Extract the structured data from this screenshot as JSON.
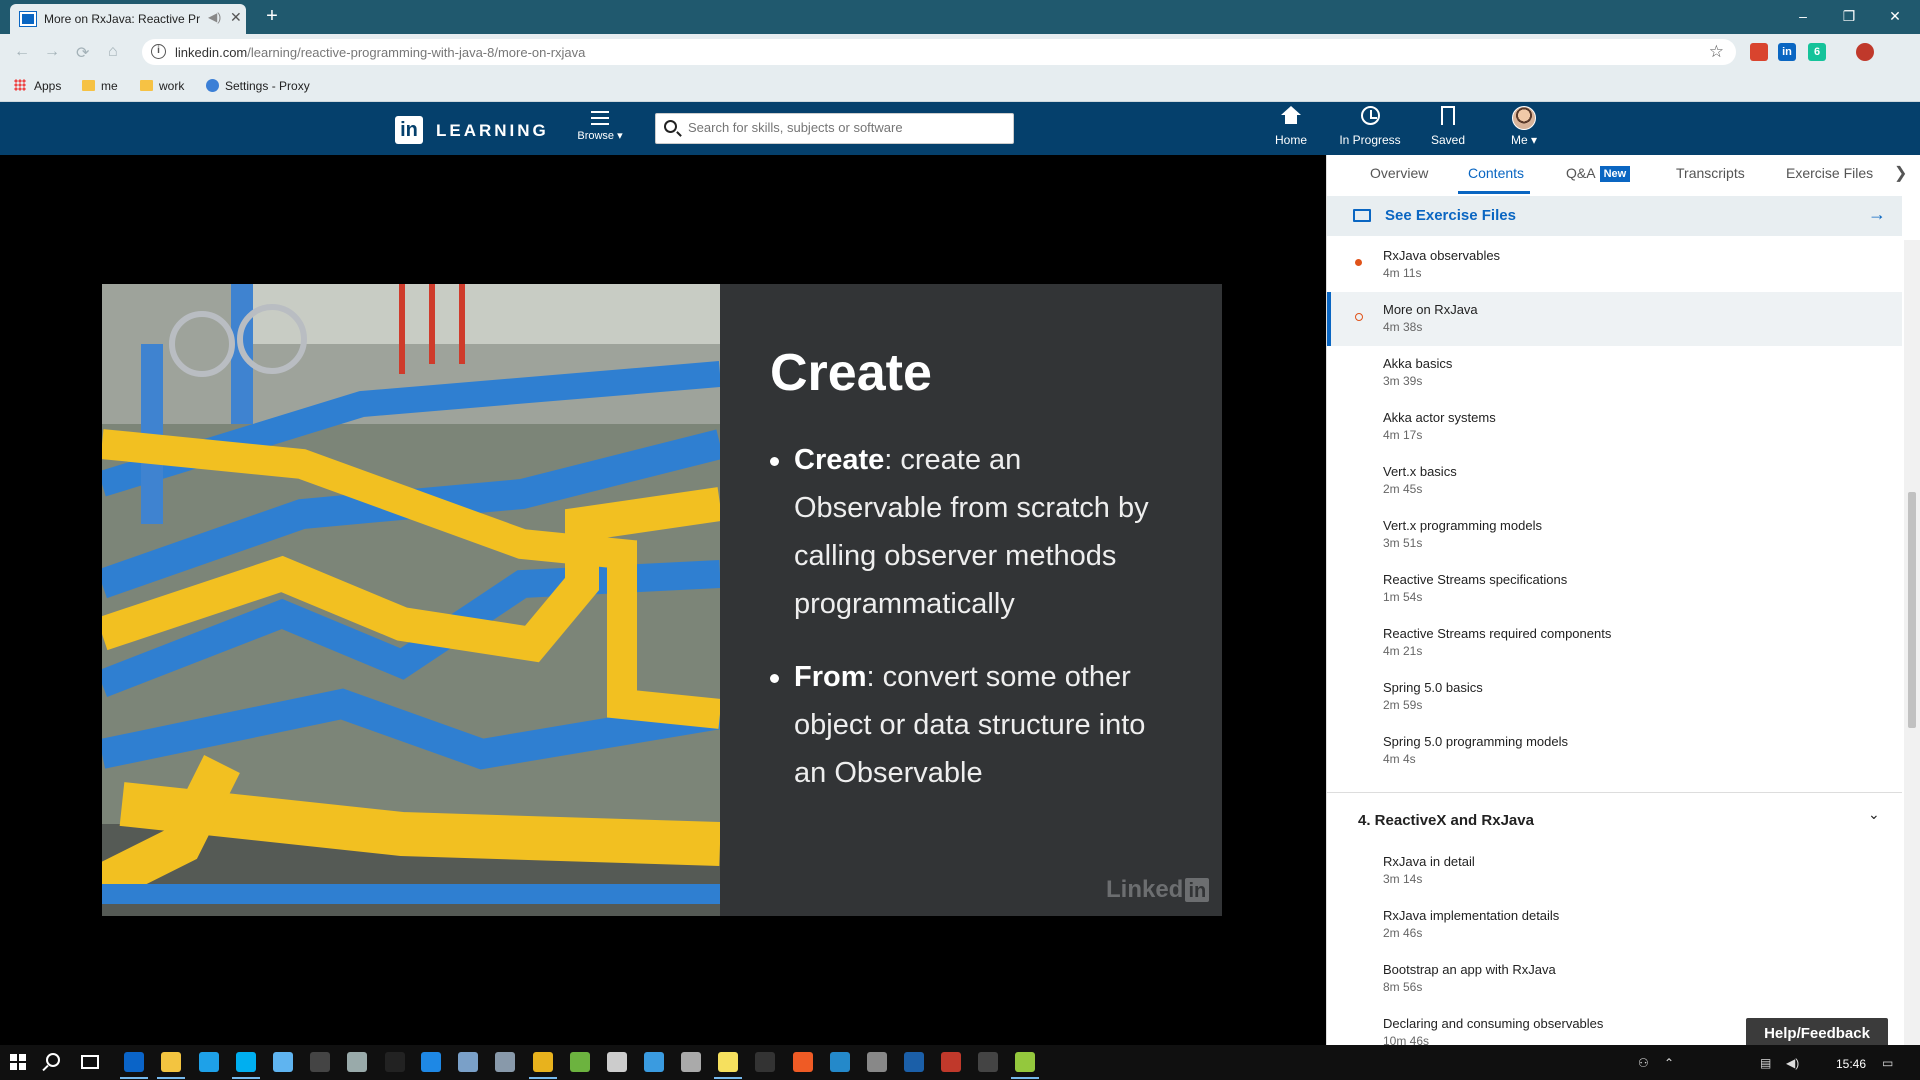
{
  "browser": {
    "tab_title": "More on RxJava: Reactive Pr",
    "new_tab": "+",
    "url_host": "linkedin.com",
    "url_path": "/learning/reactive-programming-with-java-8/more-on-rxjava",
    "window_controls": [
      "–",
      "❐",
      "✕"
    ],
    "nav": [
      "←",
      "→",
      "⟳",
      "⌂"
    ],
    "extensions": [
      {
        "icon": "chrome-extension-icon",
        "color": "#d9442e",
        "label": ""
      },
      {
        "icon": "linkedin-extension-icon",
        "color": "#0a66c2",
        "label": "in"
      },
      {
        "icon": "grammarly-extension-icon",
        "color": "#15c39a",
        "label": "6"
      },
      {
        "icon": "adblock-extension-icon",
        "color": "#c0392b",
        "label": ""
      }
    ],
    "bookmarks": [
      "Apps",
      "me",
      "work",
      "Settings - Proxy"
    ]
  },
  "header": {
    "logo_in": "in",
    "logo_text": "LEARNING",
    "browse": "Browse ▾",
    "search_placeholder": "Search for skills, subjects or software",
    "nav": {
      "home": "Home",
      "in_progress": "In Progress",
      "saved": "Saved",
      "me": "Me ▾"
    }
  },
  "slide": {
    "title": "Create",
    "bullets": [
      {
        "term": "Create",
        "text": ": create an Observable from scratch by calling observer methods programmatically"
      },
      {
        "term": "From",
        "text": ": convert some other object or data structure into an Observable"
      }
    ],
    "watermark_text": "Linked",
    "watermark_in": "in"
  },
  "panel": {
    "tabs": [
      "Overview",
      "Contents",
      "Q&A",
      "Transcripts",
      "Exercise Files"
    ],
    "active_tab": "Contents",
    "new_badge": "New",
    "next_arrow": "❯",
    "exercise_files": "See Exercise Files",
    "exercise_arrow": "→",
    "items": [
      {
        "title": "RxJava observables",
        "duration": "4m 11s",
        "status": "watched"
      },
      {
        "title": "More on RxJava",
        "duration": "4m 38s",
        "status": "current"
      },
      {
        "title": "Akka basics",
        "duration": "3m 39s",
        "status": "none"
      },
      {
        "title": "Akka actor systems",
        "duration": "4m 17s",
        "status": "none"
      },
      {
        "title": "Vert.x basics",
        "duration": "2m 45s",
        "status": "none"
      },
      {
        "title": "Vert.x programming models",
        "duration": "3m 51s",
        "status": "none"
      },
      {
        "title": "Reactive Streams specifications",
        "duration": "1m 54s",
        "status": "none"
      },
      {
        "title": "Reactive Streams required components",
        "duration": "4m 21s",
        "status": "none"
      },
      {
        "title": "Spring 5.0 basics",
        "duration": "2m 59s",
        "status": "none"
      },
      {
        "title": "Spring 5.0 programming models",
        "duration": "4m 4s",
        "status": "none"
      }
    ],
    "section4": {
      "title": "4. ReactiveX and RxJava",
      "chevron": "⌄",
      "items": [
        {
          "title": "RxJava in detail",
          "duration": "3m 14s"
        },
        {
          "title": "RxJava implementation details",
          "duration": "2m 46s"
        },
        {
          "title": "Bootstrap an app with RxJava",
          "duration": "8m 56s"
        },
        {
          "title": "Declaring and consuming observables",
          "duration": "10m 46s"
        }
      ]
    },
    "help": "Help/Feedback"
  },
  "taskbar": {
    "time": "15:46",
    "apps": [
      {
        "name": "outlook-icon",
        "color": "#0a64c8"
      },
      {
        "name": "file-explorer-icon",
        "color": "#f3c440"
      },
      {
        "name": "internet-explorer-icon",
        "color": "#1ea1e8"
      },
      {
        "name": "skype-icon",
        "color": "#00aff0"
      },
      {
        "name": "sourcetree-icon",
        "color": "#5fb4f0"
      },
      {
        "name": "cmd-icon",
        "color": "#444444"
      },
      {
        "name": "app-icon",
        "color": "#9aa"
      },
      {
        "name": "intellij-icon",
        "color": "#222222"
      },
      {
        "name": "info-app-icon",
        "color": "#1e88e5"
      },
      {
        "name": "virtualbox-icon",
        "color": "#7aa0c8"
      },
      {
        "name": "shield-app-icon",
        "color": "#8899aa"
      },
      {
        "name": "chrome-icon",
        "color": "#e8b21d"
      },
      {
        "name": "leaf-app-icon",
        "color": "#6cb33f"
      },
      {
        "name": "network-app-icon",
        "color": "#cccccc"
      },
      {
        "name": "remote-desktop-icon",
        "color": "#3a9be0"
      },
      {
        "name": "paint-icon",
        "color": "#aaaaaa"
      },
      {
        "name": "sticky-notes-icon",
        "color": "#f6e05e"
      },
      {
        "name": "jetbrains-icon",
        "color": "#333333"
      },
      {
        "name": "postman-icon",
        "color": "#ef5b25"
      },
      {
        "name": "vscode-icon",
        "color": "#2489ca"
      },
      {
        "name": "tool-app-icon",
        "color": "#888888"
      },
      {
        "name": "putty-icon",
        "color": "#1b5fa8"
      },
      {
        "name": "winrar-icon",
        "color": "#c0392b"
      },
      {
        "name": "7zip-icon",
        "color": "#444444"
      },
      {
        "name": "notepad-icon",
        "color": "#94c83d"
      }
    ]
  }
}
